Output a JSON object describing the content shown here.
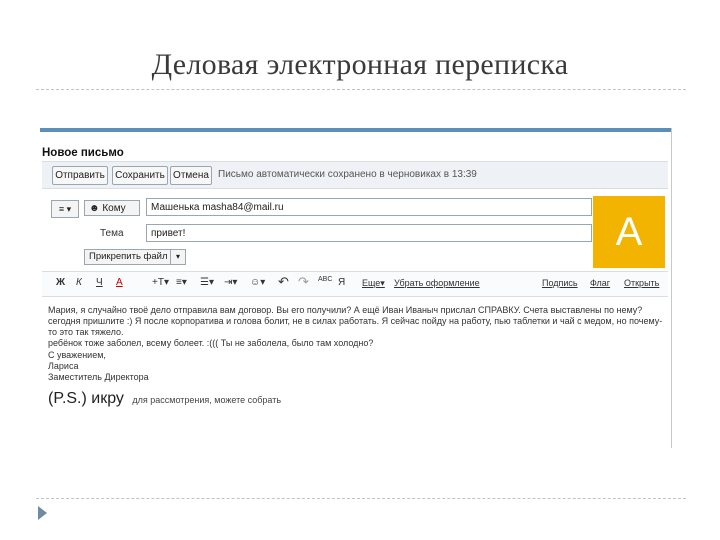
{
  "slide": {
    "title": "Деловая электронная переписка"
  },
  "window": {
    "title": "Новое письмо"
  },
  "toolbar": {
    "send_label": "Отправить",
    "save_label": "Сохранить",
    "cancel_label": "Отмена",
    "autosave_text": "Письмо автоматически сохранено в черновиках в 13:39"
  },
  "compose": {
    "to_selector": "≡ ▾",
    "to_button": "Кому",
    "to_value": "Машенька masha84@mail.ru",
    "subject_label": "Тема",
    "subject_value": "привет!",
    "attach_label": "Прикрепить файл",
    "attach_arrow": "▾"
  },
  "avatar": {
    "letter": "А",
    "color": "#f2b400"
  },
  "format_bar": {
    "bold": "Ж",
    "italic": "К",
    "underline": "Ч",
    "font_color": "А",
    "text_size": "+T▾",
    "align": "≡▾",
    "list_bullets": "☰▾",
    "indent": "⇥▾",
    "smiley": "☺▾",
    "undo": "↶",
    "redo": "↷",
    "spellcheck": "ABC",
    "translit": "Я",
    "more": "Еще▾",
    "remove_format": "Убрать оформление",
    "signature": "Подпись",
    "translate": "Флаг",
    "open": "Открыть"
  },
  "message": {
    "line1": "Мария, я случайно твоё дело отправила вам договор. Вы его получили? А ещё Иван Иваныч прислал СПРАВКУ. Счета выставлены по нему?",
    "line2": "сегодня пришлите :) Я после корпоратива и голова болит, не в силах работать. Я сейчас пойду на работу, пью таблетки и чай с медом, но почему-то это так тяжело.",
    "line3": "ребёнок тоже заболел, всему болеет. :((( Ты не заболела, было там холодно?",
    "sig_greeting": "С уважением,",
    "sig_name": "Лариса",
    "sig_title": "Заместитель Директора",
    "ps_big": "(P.S.) икру",
    "ps_small": "для рассмотрения, можете собрать"
  }
}
